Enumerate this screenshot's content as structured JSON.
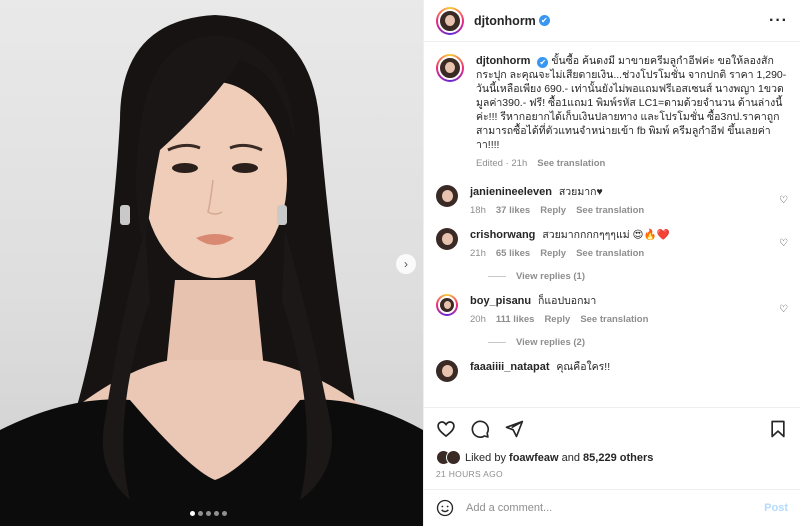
{
  "post": {
    "username": "djtonhorm",
    "verified_mark": "✔",
    "more_icon": "more-horizontal-icon"
  },
  "photo": {
    "next_icon": "chevron-right-icon",
    "slides": 5,
    "current_slide": 1
  },
  "caption": {
    "username": "djtonhorm",
    "text": "ขั้นซื้อ ค้นดงมี มาขายครีมลูกำอีฟค่ะ ขอให้ลองสักกระปุก ละคุณจะไม่เสียดายเงิน...ช่วงโปรโมชั่น จากปกติ ราคา 1,290- วันนี้เหลือเพียง 690.- เท่านั้นยังไม่พอแถมฟรีเอสเซนส์ นางพญา 1ขวด มูลค่า390.- ฟรี! ซื้อ1แถม1 พิมพ์รหัส LC1=ดามด้วยจำนวน ด้านล่างนี้ค่ะ!!! รีหากอยากได้เก็บเงินปลายทาง และโปรโมชั่น ซื้อ3กป.ราคาถูก สามารถซื้อได้ที่ตัวแทนจำหน่ายเข้า fb พิมพ์ ครีมลูกำอีฟ ขึ้นเลยค่าาา!!!!",
    "edited": "Edited · 21h",
    "see_translation": "See translation"
  },
  "comments": [
    {
      "user": "janienineeleven",
      "text": "สวยมาก♥",
      "time": "18h",
      "likes": "37 likes",
      "reply": "Reply",
      "see_translation": "See translation"
    },
    {
      "user": "crishorwang",
      "text": "สวยมากกกกๆๆๆแม่ 😍🔥❤️",
      "time": "21h",
      "likes": "65 likes",
      "reply": "Reply",
      "see_translation": "See translation",
      "view_replies": "View replies (1)"
    },
    {
      "user": "boy_pisanu",
      "text": "ก็แอปบอกมา",
      "time": "20h",
      "likes": "111 likes",
      "reply": "Reply",
      "see_translation": "See translation",
      "view_replies": "View replies (2)"
    },
    {
      "user": "faaaiiii_natapat",
      "text": "คุณคือใคร!!"
    }
  ],
  "actions": {
    "like_icon": "heart-icon",
    "comment_icon": "comment-icon",
    "share_icon": "send-icon",
    "save_icon": "bookmark-icon",
    "liked_by_prefix": "Liked by",
    "liked_by_user": "foawfeaw",
    "liked_by_and": "and",
    "liked_by_count": "85,229 others",
    "time_ago": "21 HOURS AGO"
  },
  "add_comment": {
    "emoji_icon": "emoji-icon",
    "placeholder": "Add a comment...",
    "post_label": "Post"
  }
}
